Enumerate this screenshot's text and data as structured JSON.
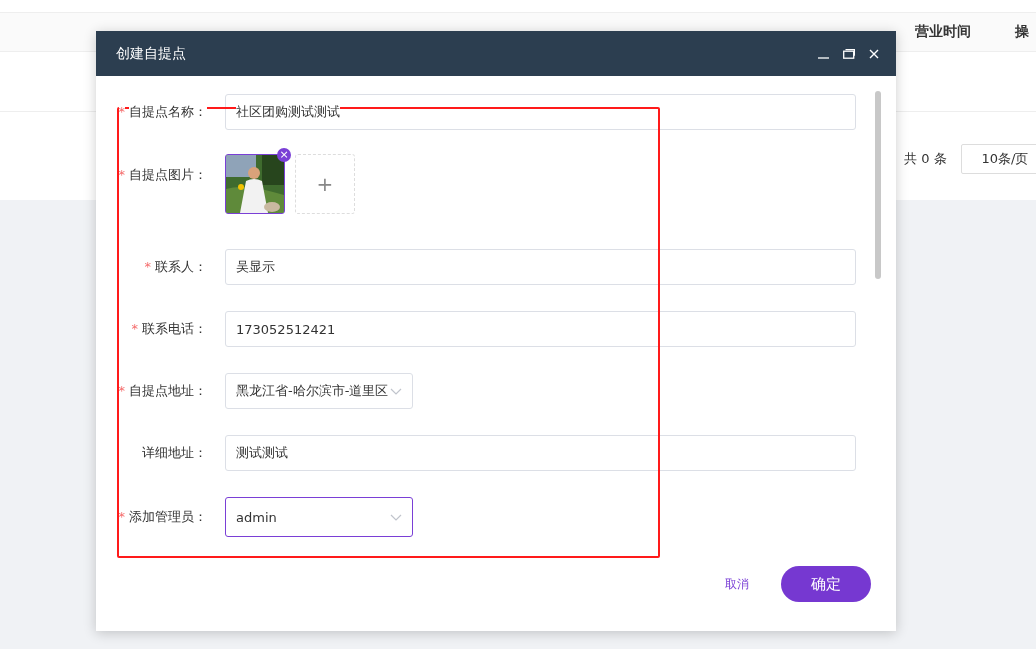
{
  "background_table": {
    "columns": [
      "营业时间",
      "操"
    ],
    "pagination": {
      "total": "共 0 条",
      "page_size": "10条/页"
    }
  },
  "dialog": {
    "title": "创建自提点",
    "fields": [
      {
        "kind": "text",
        "label": "自提点名称：",
        "required_mark": "*",
        "value": "社区团购测试测试",
        "focused": false
      },
      {
        "label": "自提点图片：",
        "required_mark": "*",
        "add_icon": "+",
        "remove_icon": "×"
      },
      {
        "kind": "text",
        "label": "联系人：",
        "required_mark": "*",
        "value": "吴显示",
        "focused": false
      },
      {
        "kind": "text",
        "label": "联系电话：",
        "required_mark": "*",
        "value": "173052512421",
        "focused": false
      },
      {
        "kind": "select",
        "label": "自提点地址：",
        "required_mark": "*",
        "value": "黑龙江省-哈尔滨市-道里区",
        "focused": false
      },
      {
        "kind": "text",
        "label": "详细地址：",
        "value": "测试测试",
        "focused": false
      },
      {
        "kind": "select",
        "label": "添加管理员：",
        "required_mark": "*",
        "value": "admin",
        "focused": true
      }
    ],
    "buttons": {
      "cancel": "取消",
      "confirm": "确定"
    }
  }
}
